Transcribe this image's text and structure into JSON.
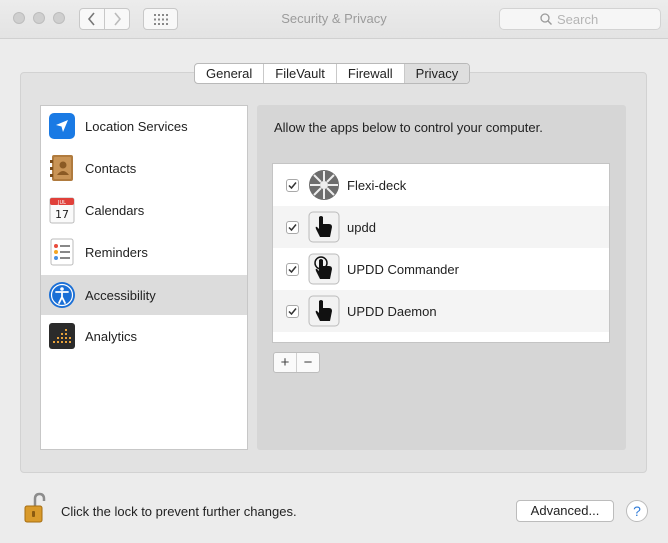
{
  "window": {
    "title": "Security & Privacy"
  },
  "search": {
    "placeholder": "Search"
  },
  "tabs": [
    {
      "label": "General"
    },
    {
      "label": "FileVault"
    },
    {
      "label": "Firewall"
    },
    {
      "label": "Privacy",
      "active": true
    }
  ],
  "sidebar": {
    "items": [
      {
        "label": "Location Services",
        "icon": "location-arrow-icon"
      },
      {
        "label": "Contacts",
        "icon": "contacts-book-icon"
      },
      {
        "label": "Calendars",
        "icon": "calendar-icon",
        "calendar_month": "JUL",
        "calendar_day": "17"
      },
      {
        "label": "Reminders",
        "icon": "reminders-list-icon"
      },
      {
        "label": "Accessibility",
        "icon": "accessibility-person-icon",
        "selected": true
      },
      {
        "label": "Analytics",
        "icon": "analytics-grid-icon"
      }
    ]
  },
  "main": {
    "description": "Allow the apps below to control your computer.",
    "apps": [
      {
        "name": "Flexi-deck",
        "checked": true,
        "icon": "flexi-deck-icon"
      },
      {
        "name": "updd",
        "checked": true,
        "icon": "touch-hand-icon"
      },
      {
        "name": "UPDD Commander",
        "checked": true,
        "icon": "touch-hand-commander-icon"
      },
      {
        "name": "UPDD Daemon",
        "checked": true,
        "icon": "touch-hand-icon"
      }
    ],
    "add_label": "+",
    "remove_label": "−"
  },
  "footer": {
    "lock_text": "Click the lock to prevent further changes.",
    "advanced_label": "Advanced...",
    "help_label": "?"
  },
  "colors": {
    "accent": "#2f7bd8",
    "selected_row": "#dcdcdc"
  }
}
